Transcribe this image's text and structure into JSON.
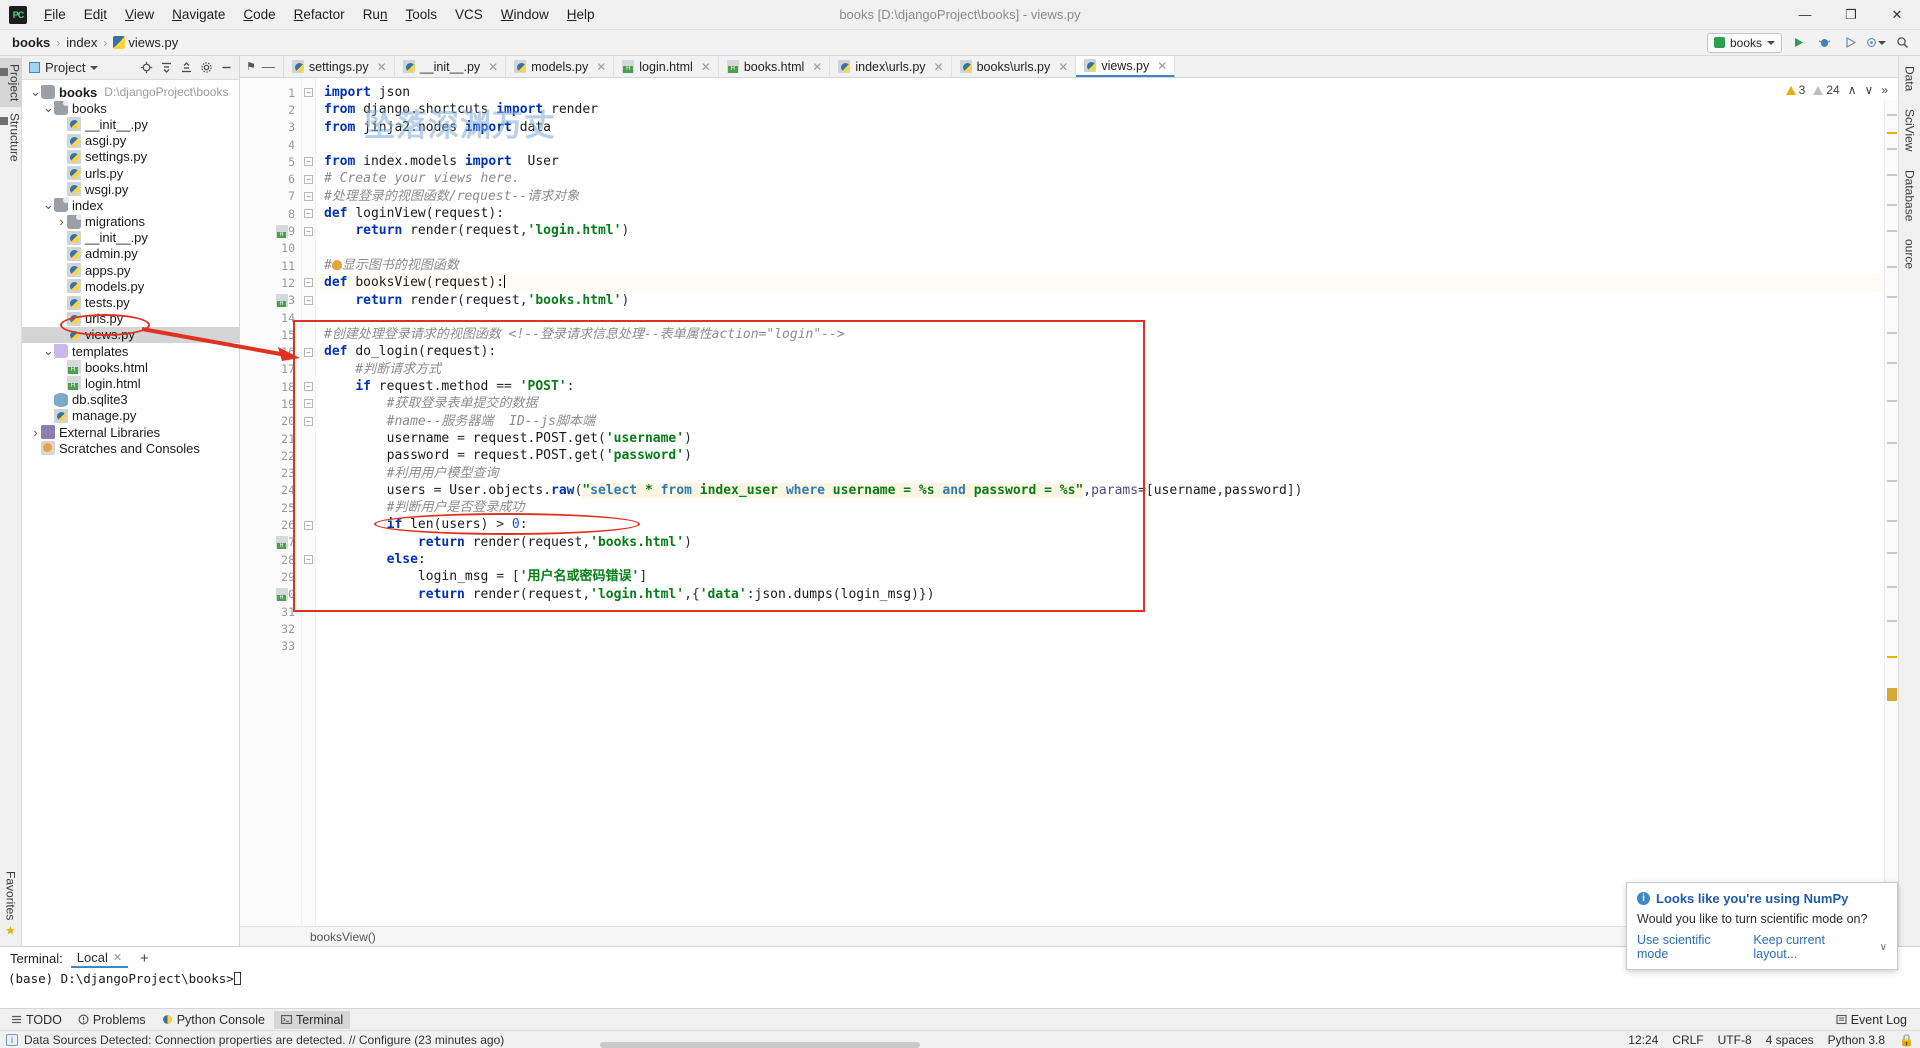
{
  "window": {
    "title": "books [D:\\djangoProject\\books] - views.py",
    "logo": "PC",
    "minimize": "—",
    "maximize": "❐",
    "close": "✕"
  },
  "menu": [
    {
      "label": "File"
    },
    {
      "label": "Edit"
    },
    {
      "label": "View"
    },
    {
      "label": "Navigate"
    },
    {
      "label": "Code"
    },
    {
      "label": "Refactor"
    },
    {
      "label": "Run"
    },
    {
      "label": "Tools"
    },
    {
      "label": "VCS"
    },
    {
      "label": "Window"
    },
    {
      "label": "Help"
    }
  ],
  "breadcrumb": {
    "items": [
      "books",
      "index",
      "views.py"
    ],
    "separator": "›"
  },
  "run_toolbar": {
    "config_name": "books",
    "run": "▶",
    "debug": "🐞",
    "coverage": "⮔",
    "profile": "◉",
    "search": "🔍"
  },
  "left_stripe": [
    {
      "label": "Project",
      "active": true
    },
    {
      "label": "Structure",
      "active": false
    },
    {
      "label": "Favorites",
      "active": false
    }
  ],
  "right_stripe": [
    {
      "label": "Database",
      "active": false
    },
    {
      "label": "SciView",
      "active": false
    },
    {
      "label": "Data",
      "active": false
    },
    {
      "label": "ource",
      "active": false
    }
  ],
  "project_panel": {
    "title": "Project",
    "actions": [
      "locate-icon",
      "collapse-icon",
      "expand-icon",
      "settings-icon",
      "hide-icon"
    ],
    "tree": [
      {
        "depth": 0,
        "arrow": "v",
        "icon": "folder-root",
        "label": "books",
        "path": "D:\\djangoProject\\books",
        "bold": true,
        "selected": false
      },
      {
        "depth": 1,
        "arrow": "v",
        "icon": "folder-module",
        "label": "books",
        "path": "",
        "bold": false,
        "selected": false
      },
      {
        "depth": 2,
        "arrow": "",
        "icon": "python",
        "label": "__init__.py",
        "path": "",
        "bold": false,
        "selected": false
      },
      {
        "depth": 2,
        "arrow": "",
        "icon": "python",
        "label": "asgi.py",
        "path": "",
        "bold": false,
        "selected": false
      },
      {
        "depth": 2,
        "arrow": "",
        "icon": "python",
        "label": "settings.py",
        "path": "",
        "bold": false,
        "selected": false
      },
      {
        "depth": 2,
        "arrow": "",
        "icon": "python",
        "label": "urls.py",
        "path": "",
        "bold": false,
        "selected": false
      },
      {
        "depth": 2,
        "arrow": "",
        "icon": "python",
        "label": "wsgi.py",
        "path": "",
        "bold": false,
        "selected": false
      },
      {
        "depth": 1,
        "arrow": "v",
        "icon": "folder-module",
        "label": "index",
        "path": "",
        "bold": false,
        "selected": false
      },
      {
        "depth": 2,
        "arrow": ">",
        "icon": "folder-module",
        "label": "migrations",
        "path": "",
        "bold": false,
        "selected": false
      },
      {
        "depth": 2,
        "arrow": "",
        "icon": "python",
        "label": "__init__.py",
        "path": "",
        "bold": false,
        "selected": false
      },
      {
        "depth": 2,
        "arrow": "",
        "icon": "python",
        "label": "admin.py",
        "path": "",
        "bold": false,
        "selected": false
      },
      {
        "depth": 2,
        "arrow": "",
        "icon": "python",
        "label": "apps.py",
        "path": "",
        "bold": false,
        "selected": false
      },
      {
        "depth": 2,
        "arrow": "",
        "icon": "python",
        "label": "models.py",
        "path": "",
        "bold": false,
        "selected": false
      },
      {
        "depth": 2,
        "arrow": "",
        "icon": "python",
        "label": "tests.py",
        "path": "",
        "bold": false,
        "selected": false
      },
      {
        "depth": 2,
        "arrow": "",
        "icon": "python",
        "label": "urls.py",
        "path": "",
        "bold": false,
        "selected": false
      },
      {
        "depth": 2,
        "arrow": "",
        "icon": "python",
        "label": "views.py",
        "path": "",
        "bold": false,
        "selected": true
      },
      {
        "depth": 1,
        "arrow": "v",
        "icon": "folder-tpl",
        "label": "templates",
        "path": "",
        "bold": false,
        "selected": false
      },
      {
        "depth": 2,
        "arrow": "",
        "icon": "html",
        "label": "books.html",
        "path": "",
        "bold": false,
        "selected": false
      },
      {
        "depth": 2,
        "arrow": "",
        "icon": "html",
        "label": "login.html",
        "path": "",
        "bold": false,
        "selected": false
      },
      {
        "depth": 1,
        "arrow": "",
        "icon": "db",
        "label": "db.sqlite3",
        "path": "",
        "bold": false,
        "selected": false
      },
      {
        "depth": 1,
        "arrow": "",
        "icon": "python",
        "label": "manage.py",
        "path": "",
        "bold": false,
        "selected": false
      },
      {
        "depth": 0,
        "arrow": ">",
        "icon": "lib",
        "label": "External Libraries",
        "path": "",
        "bold": false,
        "selected": false
      },
      {
        "depth": 0,
        "arrow": "",
        "icon": "scratch",
        "label": "Scratches and Consoles",
        "path": "",
        "bold": false,
        "selected": false
      }
    ]
  },
  "editor": {
    "tabs": [
      {
        "label": "settings.py",
        "icon": "python",
        "active": false
      },
      {
        "label": "__init__.py",
        "icon": "python",
        "active": false
      },
      {
        "label": "models.py",
        "icon": "python",
        "active": false
      },
      {
        "label": "login.html",
        "icon": "html",
        "active": false
      },
      {
        "label": "books.html",
        "icon": "html",
        "active": false
      },
      {
        "label": "index\\urls.py",
        "icon": "python",
        "active": false
      },
      {
        "label": "books\\urls.py",
        "icon": "python",
        "active": false
      },
      {
        "label": "views.py",
        "icon": "python",
        "active": true
      }
    ],
    "tab_close_glyph": "✕",
    "pin_glyph": "⚑",
    "minimize_glyph": "—",
    "watermark": "坠落深渊万丈",
    "inspections": {
      "warnings": "3",
      "weak_warnings": "24",
      "up": "∧",
      "down": "∨",
      "more": "»"
    },
    "breadcrumb_bottom": "booksView()",
    "caret_line": 12,
    "lines": [
      {
        "n": 1,
        "text": "import json",
        "fold": "minus",
        "gmark": ""
      },
      {
        "n": 2,
        "text": "from django.shortcuts import render",
        "fold": "",
        "gmark": ""
      },
      {
        "n": 3,
        "text": "from jinja2.nodes import data",
        "fold": "",
        "gmark": ""
      },
      {
        "n": 4,
        "text": "",
        "fold": "",
        "gmark": ""
      },
      {
        "n": 5,
        "text": "from index.models import  User",
        "fold": "minus",
        "gmark": ""
      },
      {
        "n": 6,
        "text": "# Create your views here.",
        "fold": "minus",
        "gmark": ""
      },
      {
        "n": 7,
        "text": "#处理登录的视图函数/request--请求对象",
        "fold": "minus",
        "gmark": ""
      },
      {
        "n": 8,
        "text": "def loginView(request):",
        "fold": "minus",
        "gmark": ""
      },
      {
        "n": 9,
        "text": "    return render(request,'login.html')",
        "fold": "minus",
        "gmark": "html"
      },
      {
        "n": 10,
        "text": "",
        "fold": "",
        "gmark": ""
      },
      {
        "n": 11,
        "text": "#显示图书的视图函数",
        "fold": "",
        "gmark": ""
      },
      {
        "n": 12,
        "text": "def booksView(request):",
        "fold": "minus",
        "gmark": ""
      },
      {
        "n": 13,
        "text": "    return render(request,'books.html')",
        "fold": "minus",
        "gmark": "html"
      },
      {
        "n": 14,
        "text": "",
        "fold": "",
        "gmark": ""
      },
      {
        "n": 15,
        "text": "#创建处理登录请求的视图函数 <!--登录请求信息处理--表单属性action=\"login\"-->",
        "fold": "",
        "gmark": ""
      },
      {
        "n": 16,
        "text": "def do_login(request):",
        "fold": "minus",
        "gmark": ""
      },
      {
        "n": 17,
        "text": "    #判断请求方式",
        "fold": "",
        "gmark": ""
      },
      {
        "n": 18,
        "text": "    if request.method == 'POST':",
        "fold": "minus",
        "gmark": ""
      },
      {
        "n": 19,
        "text": "        #获取登录表单提交的数据",
        "fold": "minus",
        "gmark": ""
      },
      {
        "n": 20,
        "text": "        #name--服务器端  ID--js脚本端",
        "fold": "minus",
        "gmark": ""
      },
      {
        "n": 21,
        "text": "        username = request.POST.get('username')",
        "fold": "",
        "gmark": ""
      },
      {
        "n": 22,
        "text": "        password = request.POST.get('password')",
        "fold": "",
        "gmark": ""
      },
      {
        "n": 23,
        "text": "        #利用用户模型查询",
        "fold": "",
        "gmark": ""
      },
      {
        "n": 24,
        "text": "        users = User.objects.raw(\"select * from index_user where username = %s and password = %s\",params=[username,password])",
        "fold": "",
        "gmark": ""
      },
      {
        "n": 25,
        "text": "        #判断用户是否登录成功",
        "fold": "",
        "gmark": ""
      },
      {
        "n": 26,
        "text": "        if len(users) > 0:",
        "fold": "minus",
        "gmark": ""
      },
      {
        "n": 27,
        "text": "            return render(request,'books.html')",
        "fold": "",
        "gmark": "html"
      },
      {
        "n": 28,
        "text": "        else:",
        "fold": "minus",
        "gmark": ""
      },
      {
        "n": 29,
        "text": "            login_msg = ['用户名或密码错误']",
        "fold": "",
        "gmark": ""
      },
      {
        "n": 30,
        "text": "            return render(request,'login.html',{'data':json.dumps(login_msg)})",
        "fold": "",
        "gmark": "html"
      },
      {
        "n": 31,
        "text": "",
        "fold": "",
        "gmark": ""
      },
      {
        "n": 32,
        "text": "",
        "fold": "",
        "gmark": ""
      },
      {
        "n": 33,
        "text": "",
        "fold": "",
        "gmark": ""
      }
    ]
  },
  "terminal": {
    "label": "Terminal:",
    "tab": "Local",
    "close": "✕",
    "plus": "+",
    "prompt": "(base) D:\\djangoProject\\books>"
  },
  "tool_windows": {
    "left": [
      {
        "label": "TODO",
        "icon": "todo-icon",
        "active": false
      },
      {
        "label": "Problems",
        "icon": "problems-icon",
        "active": false
      },
      {
        "label": "Python Console",
        "icon": "python-icon",
        "active": false
      },
      {
        "label": "Terminal",
        "icon": "terminal-icon",
        "active": true
      }
    ],
    "right": [
      {
        "label": "Event Log",
        "icon": "event-log-icon",
        "active": false
      }
    ]
  },
  "status_bar": {
    "message": "Data Sources Detected: Connection properties are detected. // Configure (23 minutes ago)",
    "right": [
      {
        "label": "12:24"
      },
      {
        "label": "CRLF"
      },
      {
        "label": "UTF-8"
      },
      {
        "label": "4 spaces"
      },
      {
        "label": "Python 3.8"
      },
      {
        "label": "🔒"
      }
    ]
  },
  "notification": {
    "title": "Looks like you're using NumPy",
    "body": "Would you like to turn scientific mode on?",
    "action_primary": "Use scientific mode",
    "action_secondary": "Keep current layout...",
    "info_glyph": "i",
    "caret": "∨"
  },
  "colors": {
    "accent": "#3c87c8",
    "annotation_red": "#e03020",
    "warning": "#e8b000",
    "keyword": "#0033b3",
    "string": "#067d17",
    "comment": "#8c8c8c"
  }
}
